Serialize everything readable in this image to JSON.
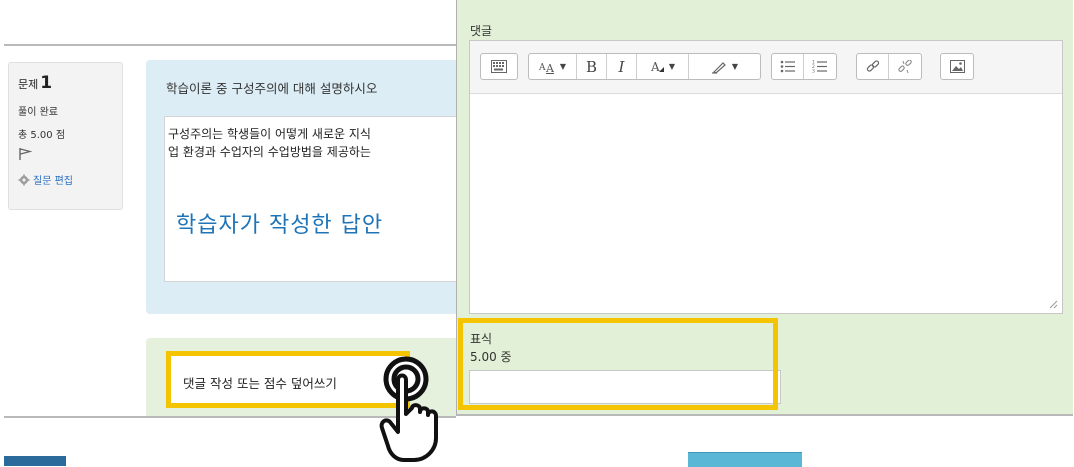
{
  "question": {
    "label": "문제",
    "number": "1",
    "state": "풀이 완료",
    "grade": "총 5.00 점",
    "edit_label": "질문 편집",
    "prompt": "학습이론 중 구성주의에 대해 설명하시오",
    "answer_line1": "구성주의는 학생들이 어떻게 새로운 지식",
    "answer_line2": "업 환경과 수업자의 수업방법을 제공하는",
    "answer_caption": "학습자가 작성한 답안"
  },
  "comment_link": "댓글 작성 또는 점수 덮어쓰기",
  "grading": {
    "comment_label": "댓글",
    "toolbar_icons": [
      "toolbar-toggle-icon",
      "font-size-icon",
      "bold-icon",
      "italic-icon",
      "font-color-icon",
      "highlight-icon",
      "bullet-list-icon",
      "numbered-list-icon",
      "link-icon",
      "unlink-icon",
      "image-icon"
    ],
    "bold_glyph": "B",
    "italic_glyph": "I",
    "mark_label": "표식",
    "out_of": "5.00 중",
    "mark_value": ""
  },
  "colors": {
    "highlight": "#f4c400",
    "question_bg": "#dcedf5",
    "comment_bg": "#e5f1dc",
    "grading_bg": "#e1f0d6",
    "answer_caption": "#1f74b8"
  }
}
